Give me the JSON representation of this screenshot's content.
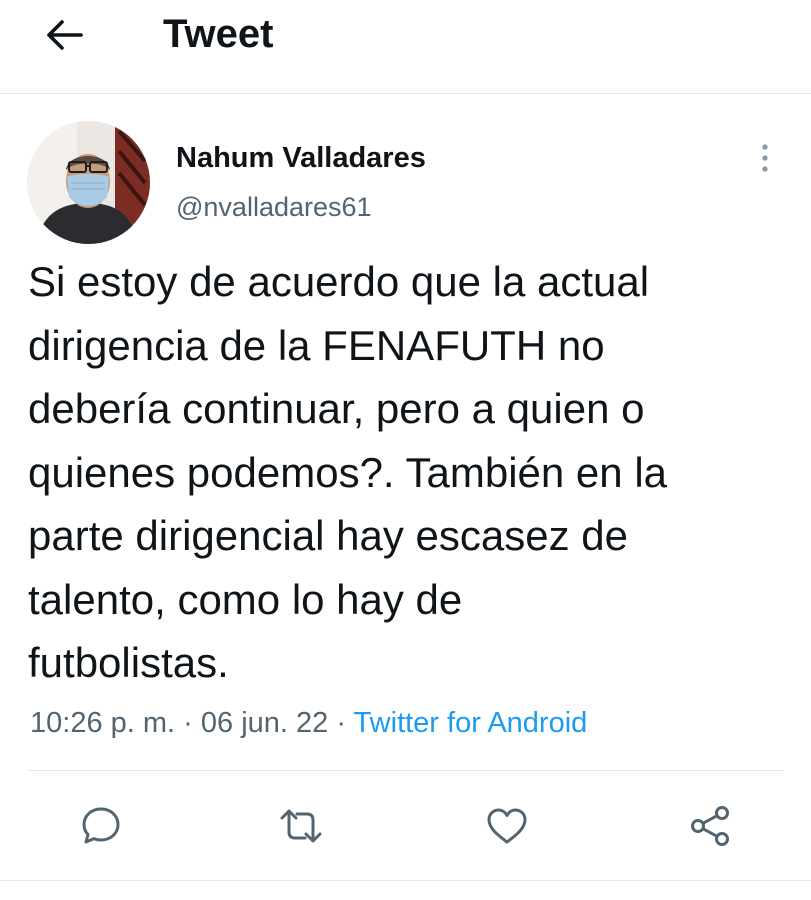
{
  "header": {
    "back_icon": "arrow-left-icon",
    "title": "Tweet"
  },
  "tweet": {
    "author": {
      "name": "Nahum Valladares",
      "handle": "@nvalladares61",
      "avatar_icon": "avatar-photo"
    },
    "more_icon": "vertical-dots-icon",
    "text": "Si estoy de acuerdo que la actual\ndirigencia de la FENAFUTH no\ndebería continuar, pero a quien o\nquienes podemos?. También en la\nparte dirigencial hay escasez de\ntalento, como lo hay de\nfutbolistas.",
    "time": "10:26 p. m.",
    "separator": "·",
    "date": "06 jun. 22",
    "source": "Twitter for Android"
  },
  "actions": [
    {
      "name": "reply",
      "icon": "comment-icon"
    },
    {
      "name": "retweet",
      "icon": "retweet-icon"
    },
    {
      "name": "like",
      "icon": "heart-icon"
    },
    {
      "name": "share",
      "icon": "share-icon"
    }
  ],
  "colors": {
    "text": "#0f1419",
    "secondary": "#536471",
    "link": "#1d9bf0",
    "divider": "#e7e9ea"
  }
}
